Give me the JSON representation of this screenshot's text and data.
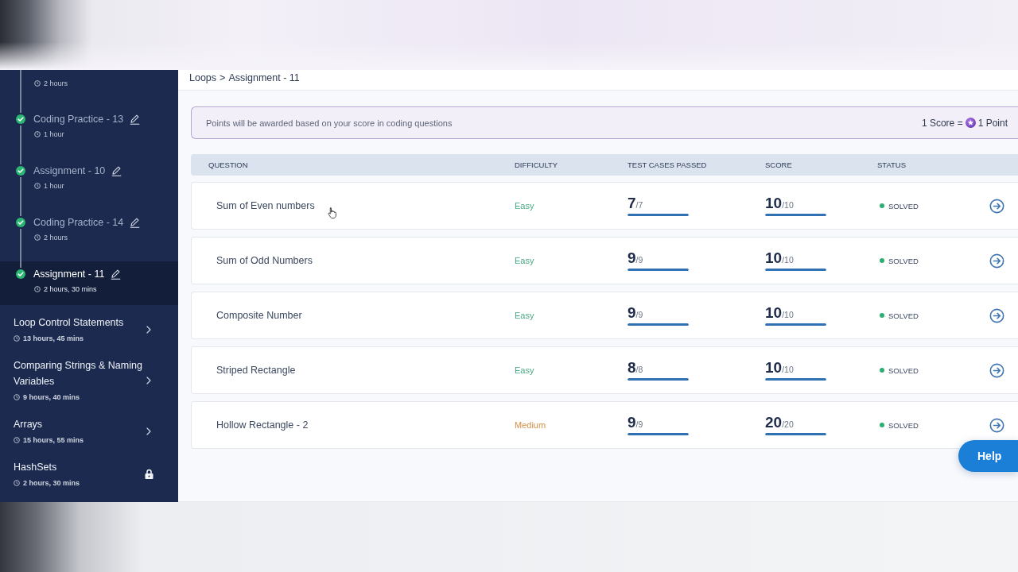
{
  "sidebar": {
    "partial_item": {
      "duration": "2 hours"
    },
    "items": [
      {
        "title": "Coding Practice - 13",
        "duration": "1 hour",
        "completed": true,
        "selected": false
      },
      {
        "title": "Assignment - 10",
        "duration": "1 hour",
        "completed": true,
        "selected": false
      },
      {
        "title": "Coding Practice - 14",
        "duration": "2 hours",
        "completed": true,
        "selected": false
      },
      {
        "title": "Assignment - 11",
        "duration": "2 hours, 30 mins",
        "completed": true,
        "selected": true
      }
    ],
    "sections": [
      {
        "title": "Loop Control Statements",
        "duration": "13 hours, 45 mins",
        "locked": false
      },
      {
        "title": "Comparing Strings & Naming Variables",
        "duration": "9 hours, 40 mins",
        "locked": false
      },
      {
        "title": "Arrays",
        "duration": "15 hours, 55 mins",
        "locked": false
      },
      {
        "title": "HashSets",
        "duration": "2 hours, 30 mins",
        "locked": true
      }
    ]
  },
  "breadcrumb": {
    "items": [
      "Loops",
      "Assignment - 11"
    ],
    "separator": ">"
  },
  "banner": {
    "message": "Points will be awarded based on your score in coding questions",
    "rate_left": "1 Score =",
    "rate_right": "1 Point"
  },
  "table": {
    "columns": [
      "QUESTION",
      "DIFFICULTY",
      "TEST CASES PASSED",
      "SCORE",
      "STATUS"
    ],
    "rows": [
      {
        "question": "Sum of Even numbers",
        "difficulty": {
          "label": "Easy",
          "color": "#48a983"
        },
        "test_cases": {
          "passed": "7",
          "total": "/7",
          "level": 1
        },
        "score": {
          "value": "10",
          "total": "/10",
          "level": 1
        },
        "status": "SOLVED"
      },
      {
        "question": "Sum of Odd Numbers",
        "difficulty": {
          "label": "Easy",
          "color": "#48a983"
        },
        "test_cases": {
          "passed": "9",
          "total": "/9",
          "level": 1
        },
        "score": {
          "value": "10",
          "total": "/10",
          "level": 1
        },
        "status": "SOLVED"
      },
      {
        "question": "Composite Number",
        "difficulty": {
          "label": "Easy",
          "color": "#48a983"
        },
        "test_cases": {
          "passed": "9",
          "total": "/9",
          "level": 1
        },
        "score": {
          "value": "10",
          "total": "/10",
          "level": 1
        },
        "status": "SOLVED"
      },
      {
        "question": "Striped Rectangle",
        "difficulty": {
          "label": "Easy",
          "color": "#48a983"
        },
        "test_cases": {
          "passed": "8",
          "total": "/8",
          "level": 1
        },
        "score": {
          "value": "10",
          "total": "/10",
          "level": 1
        },
        "status": "SOLVED"
      },
      {
        "question": "Hollow Rectangle - 2",
        "difficulty": {
          "label": "Medium",
          "color": "#d38f45"
        },
        "test_cases": {
          "passed": "9",
          "total": "/9",
          "level": 1
        },
        "score": {
          "value": "20",
          "total": "/20",
          "level": 1
        },
        "status": "SOLVED"
      }
    ]
  },
  "help_button": {
    "label": "Help"
  }
}
